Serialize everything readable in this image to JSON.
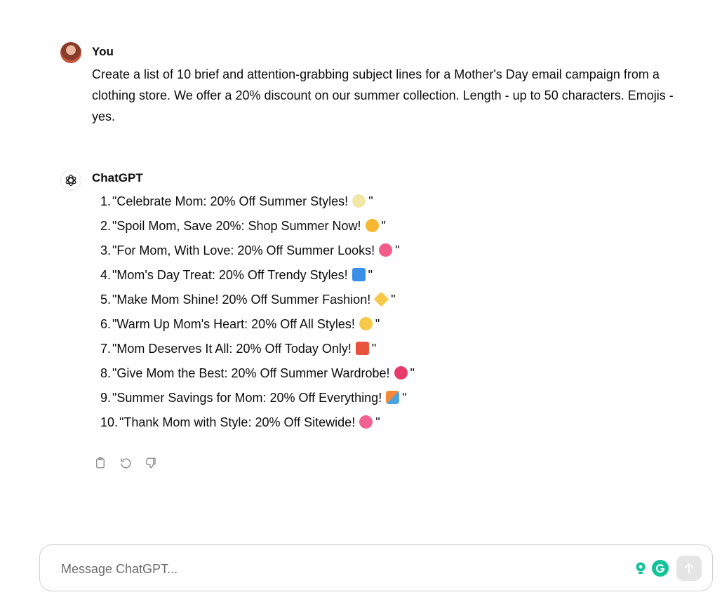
{
  "user_message": {
    "author": "You",
    "text": "Create a list of 10 brief and attention-grabbing subject lines for a Mother's Day email campaign from a clothing store. We offer a 20% discount on our summer collection. Length - up to 50 characters. Emojis - yes."
  },
  "assistant_message": {
    "author": "ChatGPT",
    "items": [
      {
        "num": "1.",
        "text": "\"Celebrate Mom: 20% Off Summer Styles!",
        "emoji": "blossom-emoji",
        "emoji_color": "#f3e7a8",
        "close": "\""
      },
      {
        "num": "2.",
        "text": "\"Spoil Mom, Save 20%: Shop Summer Now!",
        "emoji": "sun-emoji",
        "emoji_color": "#f7b731",
        "close": "\""
      },
      {
        "num": "3.",
        "text": "\"For Mom, With Love: 20% Off Summer Looks!",
        "emoji": "two-hearts-emoji",
        "emoji_color": "#f25c8a",
        "close": "\""
      },
      {
        "num": "4.",
        "text": "\"Mom's Day Treat: 20% Off Trendy Styles!",
        "emoji": "shopping-bags-emoji",
        "emoji_color": "#3a8ee6",
        "close": "\""
      },
      {
        "num": "5.",
        "text": "\"Make Mom Shine! 20% Off Summer Fashion!",
        "emoji": "sparkles-emoji",
        "emoji_color": "#f7c948",
        "close": "\""
      },
      {
        "num": "6.",
        "text": "\"Warm Up Mom's Heart: 20% Off All Styles!",
        "emoji": "smiling-hearts-emoji",
        "emoji_color": "#f7c948",
        "close": "\""
      },
      {
        "num": "7.",
        "text": "\"Mom Deserves It All: 20% Off Today Only!",
        "emoji": "gift-emoji",
        "emoji_color": "#e8533f",
        "close": "\""
      },
      {
        "num": "8.",
        "text": "\"Give Mom the Best: 20% Off Summer Wardrobe!",
        "emoji": "sparkling-heart-emoji",
        "emoji_color": "#e83a6a",
        "close": "\""
      },
      {
        "num": "9.",
        "text": "\"Summer Savings for Mom: 20% Off Everything!",
        "emoji": "beach-umbrella-emoji",
        "emoji_color": "#f08a3a",
        "close": "\""
      },
      {
        "num": "10.",
        "text": "\"Thank Mom with Style: 20% Off Sitewide!",
        "emoji": "hibiscus-emoji",
        "emoji_color": "#f06292",
        "close": "\""
      }
    ]
  },
  "actions": [
    "copy-icon",
    "regenerate-icon",
    "thumbs-down-icon"
  ],
  "composer": {
    "placeholder": "Message ChatGPT..."
  },
  "colors": {
    "text": "#0d0d0d",
    "grammarly": "#15c39a",
    "send_disabled": "#e5e5e5"
  }
}
